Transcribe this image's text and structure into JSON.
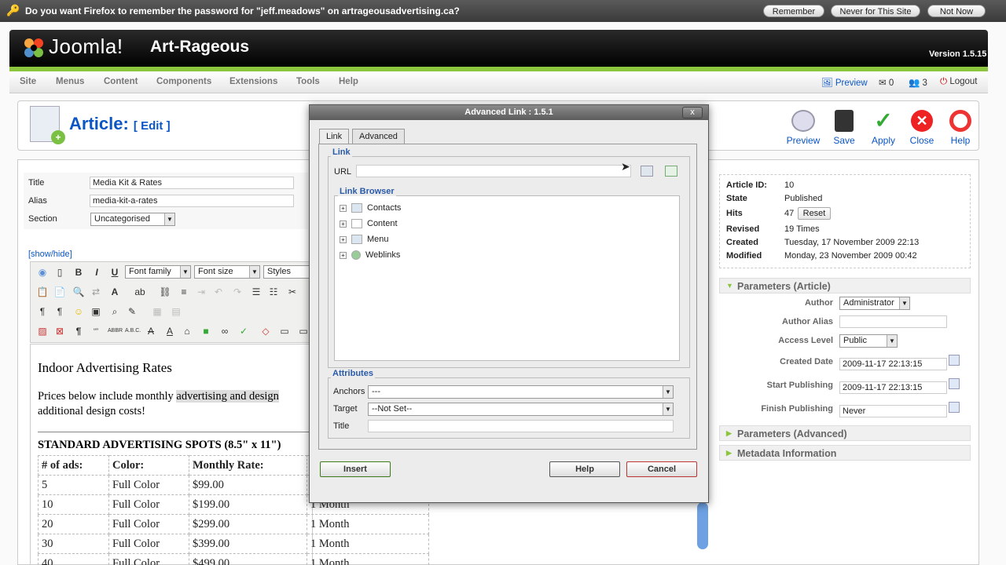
{
  "firefox_bar": {
    "message": "Do you want Firefox to remember the password for \"jeff.meadows\" on artrageousadvertising.ca?",
    "remember": "Remember",
    "never_site": "Never for This Site",
    "not_now": "Not Now"
  },
  "header": {
    "brand": "Joomla!",
    "site_name": "Art-Rageous",
    "version": "Version 1.5.15"
  },
  "menu": {
    "items": [
      "Site",
      "Menus",
      "Content",
      "Components",
      "Extensions",
      "Tools",
      "Help"
    ],
    "preview": "Preview",
    "messages": "0",
    "users": "3",
    "logout": "Logout"
  },
  "toolbar": {
    "title": "Article:",
    "subtitle": "[ Edit ]",
    "buttons": [
      "Preview",
      "Save",
      "Apply",
      "Close",
      "Help"
    ]
  },
  "form": {
    "title_label": "Title",
    "title_value": "Media Kit & Rates",
    "alias_label": "Alias",
    "alias_value": "media-kit-a-rates",
    "section_label": "Section",
    "section_value": "Uncategorised",
    "showhide": "[show/hide]",
    "font_family": "Font family",
    "font_size": "Font size",
    "styles": "Styles"
  },
  "editor": {
    "heading": "Indoor Advertising Rates",
    "para_a": "Prices below include monthly ",
    "para_hl": "advertising and design",
    "para_b": "additional design costs!",
    "std": "STANDARD ADVERTISING SPOTS (8.5\" x 11\")",
    "table_head": [
      "# of ads:",
      "Color:",
      "Monthly Rate:",
      ""
    ],
    "rows": [
      [
        "5",
        "Full Color",
        "$99.00",
        ""
      ],
      [
        "10",
        "Full Color",
        "$199.00",
        "1 Month"
      ],
      [
        "20",
        "Full Color",
        "$299.00",
        "1 Month"
      ],
      [
        "30",
        "Full Color",
        "$399.00",
        "1 Month"
      ],
      [
        "40",
        "Full Color",
        "$499.00",
        "1 Month"
      ]
    ]
  },
  "details": {
    "article_id_label": "Article ID:",
    "article_id": "10",
    "state_label": "State",
    "state": "Published",
    "hits_label": "Hits",
    "hits": "47",
    "reset": "Reset",
    "revised_label": "Revised",
    "revised": "19 Times",
    "created_label": "Created",
    "created": "Tuesday, 17 November 2009 22:13",
    "modified_label": "Modified",
    "modified": "Monday, 23 November 2009 00:42"
  },
  "params": {
    "article_header": "Parameters (Article)",
    "author_label": "Author",
    "author": "Administrator",
    "alias_label": "Author Alias",
    "alias": "",
    "access_label": "Access Level",
    "access": "Public",
    "created_label": "Created Date",
    "created": "2009-11-17 22:13:15",
    "start_label": "Start Publishing",
    "start": "2009-11-17 22:13:15",
    "finish_label": "Finish Publishing",
    "finish": "Never",
    "advanced_header": "Parameters (Advanced)",
    "meta_header": "Metadata Information"
  },
  "dialog": {
    "title": "Advanced Link : 1.5.1",
    "close": "x",
    "tab_link": "Link",
    "tab_advanced": "Advanced",
    "link_legend": "Link",
    "url_label": "URL",
    "url_value": "",
    "browser_legend": "Link Browser",
    "tree": [
      "Contacts",
      "Content",
      "Menu",
      "Weblinks"
    ],
    "attr_legend": "Attributes",
    "anchors_label": "Anchors",
    "anchors_value": "---",
    "target_label": "Target",
    "target_value": "--Not Set--",
    "title_label": "Title",
    "title_value": "",
    "insert": "Insert",
    "help": "Help",
    "cancel": "Cancel"
  }
}
